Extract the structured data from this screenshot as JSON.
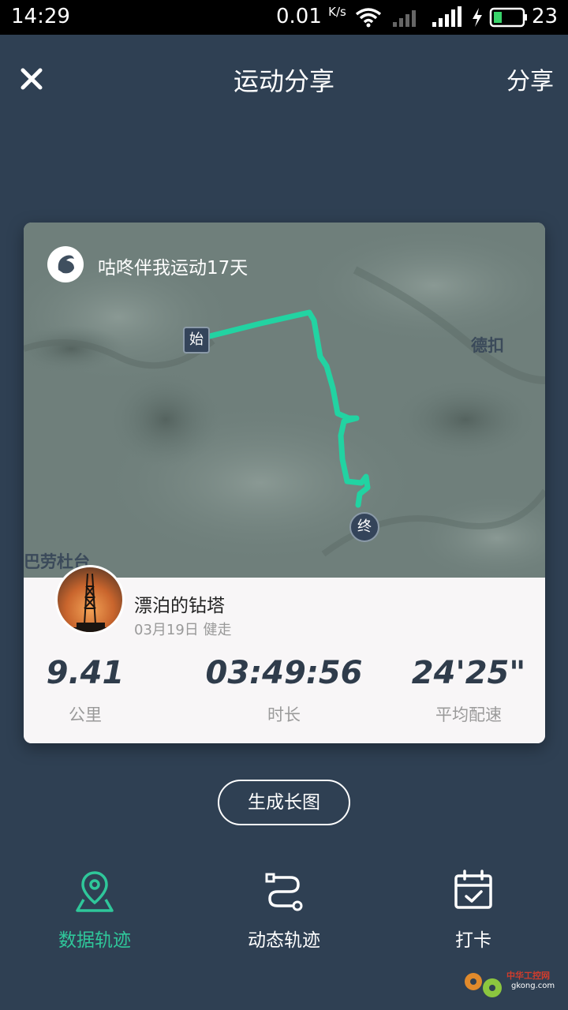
{
  "status_bar": {
    "time": "14:29",
    "net_speed": "0.01",
    "net_unit": "K/s",
    "battery": "23"
  },
  "header": {
    "title": "运动分享",
    "share_label": "分享"
  },
  "card": {
    "brand_text": "咕咚伴我运动17天",
    "places": [
      "德扣",
      "巴劳杜台"
    ],
    "start_marker": "始",
    "end_marker": "终",
    "user": {
      "name": "漂泊的钻塔",
      "meta": "03月19日 健走"
    },
    "stats": [
      {
        "value": "9.41",
        "label": "公里"
      },
      {
        "value": "03:49:56",
        "label": "时长"
      },
      {
        "value": "24'25\"",
        "label": "平均配速"
      }
    ]
  },
  "generate_button": "生成长图",
  "bottom_nav": [
    {
      "label": "数据轨迹",
      "icon": "map-pin-icon",
      "active": true
    },
    {
      "label": "动态轨迹",
      "icon": "route-icon",
      "active": false
    },
    {
      "label": "打卡",
      "icon": "calendar-check-icon",
      "active": false
    }
  ],
  "watermark": {
    "text": "中华工控网",
    "url": "gkong.com"
  },
  "colors": {
    "background": "#2f4053",
    "accent": "#2fc79a",
    "route": "#22d3a2"
  }
}
